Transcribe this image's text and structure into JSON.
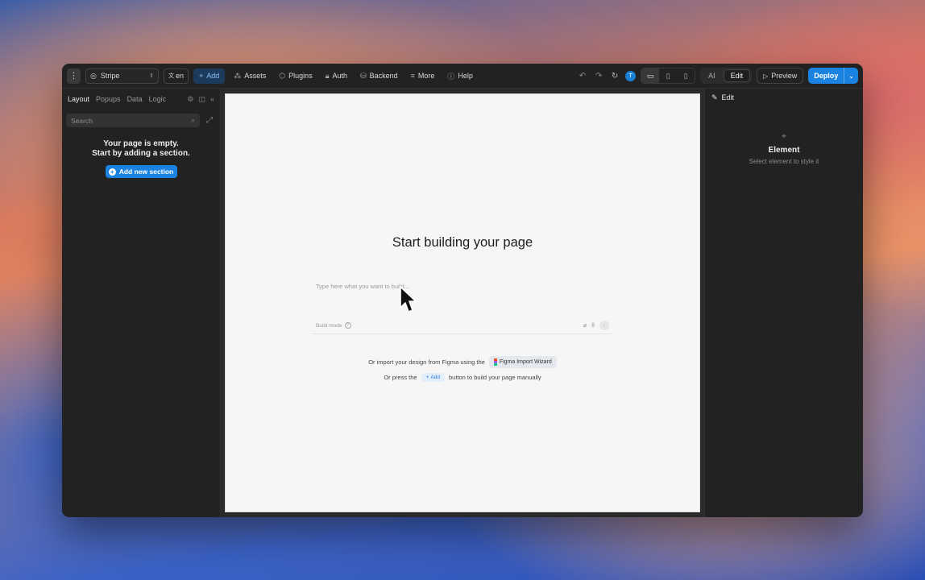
{
  "toolbar": {
    "project": "Stripe",
    "language": "en",
    "add_label": "Add",
    "assets_label": "Assets",
    "plugins_label": "Plugins",
    "auth_label": "Auth",
    "backend_label": "Backend",
    "more_label": "More",
    "help_label": "Help",
    "avatar_initial": "T",
    "mode_ai": "AI",
    "mode_edit": "Edit",
    "active_mode": "Edit",
    "preview_label": "Preview",
    "deploy_label": "Deploy",
    "accent_color": "#1a82e0"
  },
  "left_panel": {
    "tabs": [
      "Layout",
      "Popups",
      "Data",
      "Logic"
    ],
    "active_tab": "Layout",
    "search_placeholder": "Search",
    "empty_line1": "Your page is empty.",
    "empty_line2": "Start by adding a section.",
    "add_section_label": "Add new section"
  },
  "canvas": {
    "title": "Start building your page",
    "prompt_placeholder": "Type here what you want to build...",
    "build_mode_label": "Build mode",
    "import_text": "Or import your design from Figma using the",
    "figma_wizard_label": "Figma Import Wizard",
    "manual_prefix": "Or press the",
    "manual_add_label": "Add",
    "manual_suffix": "button to build your page manually"
  },
  "right_panel": {
    "header": "Edit",
    "element_title": "Element",
    "element_sub": "Select element to style it"
  }
}
